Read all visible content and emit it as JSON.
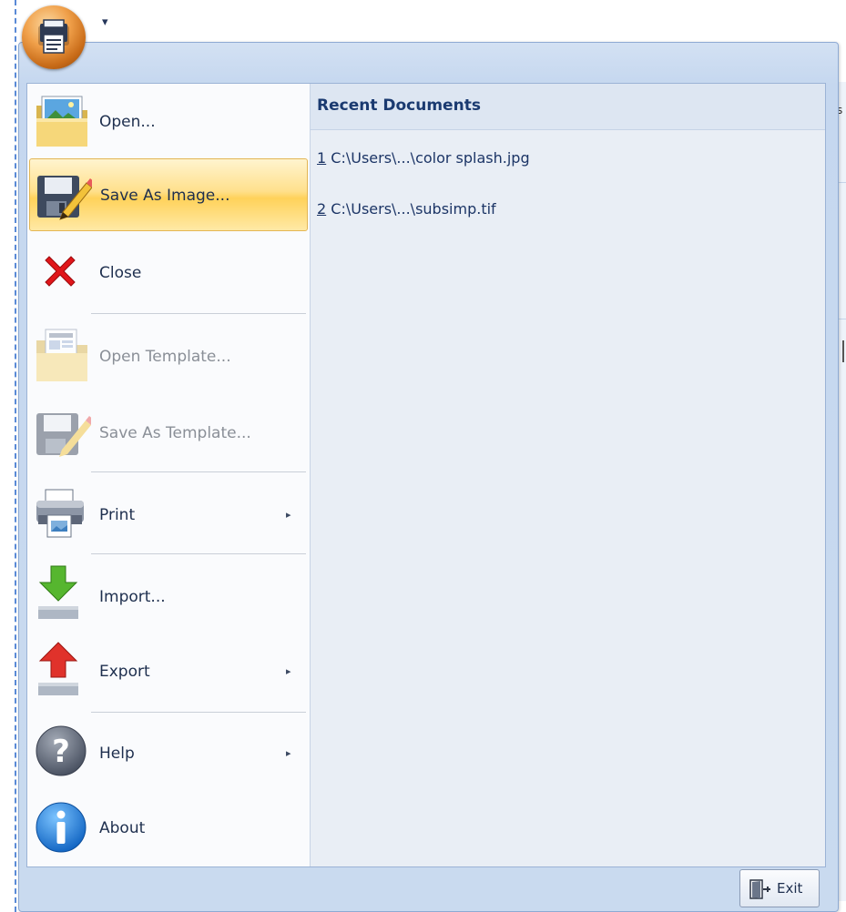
{
  "quick_access": {
    "customize_arrow": "▾"
  },
  "ribbon_edge": {
    "letter": "s"
  },
  "menu": {
    "items": [
      {
        "label": "Open...",
        "icon": "folder-picture-icon"
      },
      {
        "label": "Save As Image...",
        "icon": "save-pencil-icon",
        "state": "highlighted"
      },
      {
        "label": "Close",
        "icon": "red-x-icon"
      },
      {
        "label": "Open Template...",
        "icon": "folder-template-icon",
        "state": "disabled"
      },
      {
        "label": "Save As Template...",
        "icon": "save-template-icon",
        "state": "disabled"
      },
      {
        "label": "Print",
        "icon": "printer-icon",
        "submenu": true
      },
      {
        "label": "Import...",
        "icon": "import-arrow-icon"
      },
      {
        "label": "Export",
        "icon": "export-arrow-icon",
        "submenu": true
      },
      {
        "label": "Help",
        "icon": "help-question-icon",
        "submenu": true
      },
      {
        "label": "About",
        "icon": "info-icon"
      }
    ],
    "submenu_glyph": "▸"
  },
  "recent": {
    "title": "Recent Documents",
    "items": [
      {
        "num": "1",
        "path": " C:\\Users\\...\\color splash.jpg"
      },
      {
        "num": "2",
        "path": " C:\\Users\\...\\subsimp.tif"
      }
    ]
  },
  "exit_label": "Exit",
  "colors": {
    "highlight": "#ffd25a",
    "panel_blue": "#c5d7ef",
    "text": "#1e2f4e",
    "disabled_text": "#8a8f97"
  }
}
